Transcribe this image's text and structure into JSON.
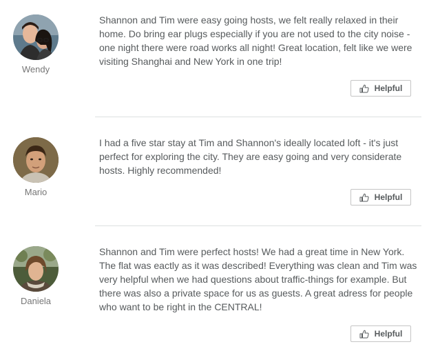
{
  "reviews": [
    {
      "reviewer": "Wendy",
      "text": "Shannon and Tim were easy going hosts, we felt really relaxed in their home. Do bring ear plugs especially if you are not used to the city noise - one night there were road works all night! Great location, felt like we were visiting Shanghai and New York in one trip!",
      "helpful_label": "Helpful"
    },
    {
      "reviewer": "Mario",
      "text": "I had a five star stay at Tim and Shannon's ideally located loft - it's just perfect for exploring the city. They are easy going and very considerate hosts. Highly recommended!",
      "helpful_label": "Helpful"
    },
    {
      "reviewer": "Daniela",
      "text": "Shannon and Tim were perfect hosts! We had a great time in New York. The flat was eactly as it was described! Everything was clean and Tim was very helpful when we had questions about traffic-things for example. But there was also a private space for us as guests. A great adress for people who want to be right in the CENTRAL!",
      "helpful_label": "Helpful"
    }
  ],
  "icons": {
    "helpful": "thumbs-up-icon"
  },
  "colors": {
    "text": "#565a5c",
    "name": "#767676",
    "divider": "#dce0e0",
    "button_border": "#c4c4c4"
  }
}
